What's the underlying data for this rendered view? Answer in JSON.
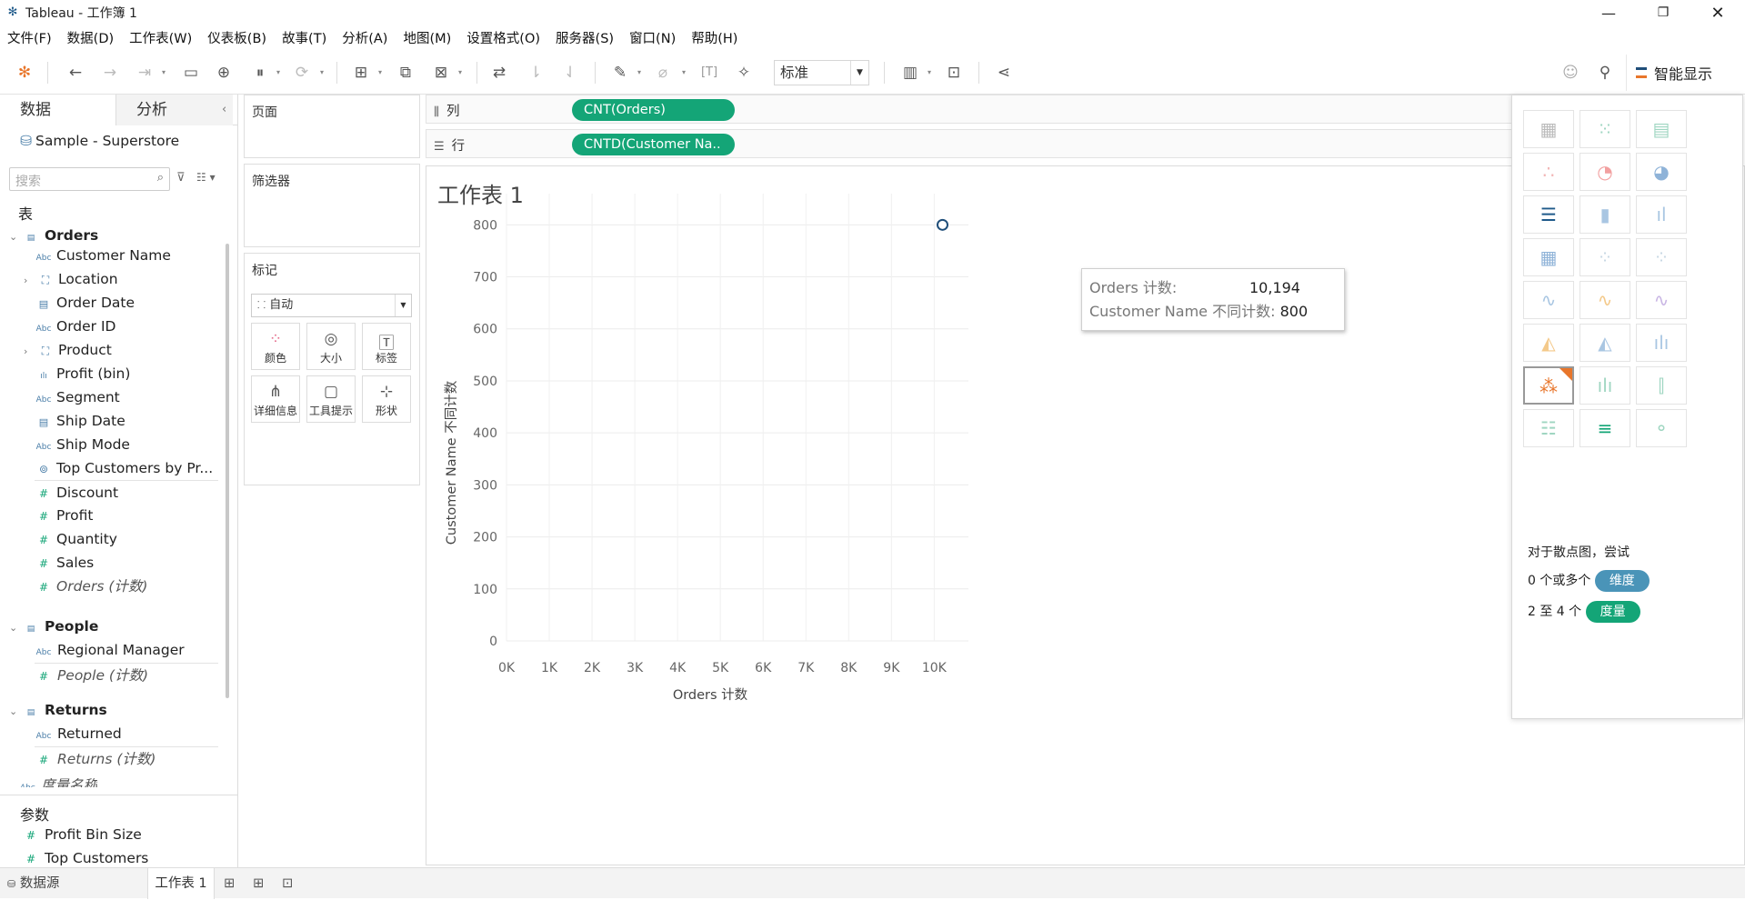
{
  "window": {
    "title": "Tableau - 工作簿 1"
  },
  "menu": [
    "文件(F)",
    "数据(D)",
    "工作表(W)",
    "仪表板(B)",
    "故事(T)",
    "分析(A)",
    "地图(M)",
    "设置格式(O)",
    "服务器(S)",
    "窗口(N)",
    "帮助(H)"
  ],
  "toolbar": {
    "view_mode": "标准",
    "smart_display": "智能显示"
  },
  "left_pane": {
    "tabs": [
      "数据",
      "分析"
    ],
    "datasource": "Sample - Superstore",
    "search_placeholder": "搜索",
    "tables_header": "表",
    "orders_table": "Orders",
    "orders_fields": [
      {
        "type": "Abc",
        "name": "Customer Name"
      },
      {
        "type": "geo",
        "name": "Location"
      },
      {
        "type": "date",
        "name": "Order Date"
      },
      {
        "type": "Abc",
        "name": "Order ID"
      },
      {
        "type": "geo",
        "name": "Product"
      },
      {
        "type": "bin",
        "name": "Profit (bin)"
      },
      {
        "type": "Abc",
        "name": "Segment"
      },
      {
        "type": "date",
        "name": "Ship Date"
      },
      {
        "type": "Abc",
        "name": "Ship Mode"
      },
      {
        "type": "set",
        "name": "Top Customers by Pr..."
      },
      {
        "type": "#",
        "name": "Discount"
      },
      {
        "type": "#",
        "name": "Profit"
      },
      {
        "type": "#",
        "name": "Quantity"
      },
      {
        "type": "#",
        "name": "Sales"
      },
      {
        "type": "#",
        "name": "Orders (计数)"
      }
    ],
    "people_table": "People",
    "people_fields": [
      {
        "type": "Abc",
        "name": "Regional Manager"
      },
      {
        "type": "#",
        "name": "People (计数)"
      }
    ],
    "returns_table": "Returns",
    "returns_fields": [
      {
        "type": "Abc",
        "name": "Returned"
      },
      {
        "type": "#",
        "name": "Returns (计数)"
      }
    ],
    "measure_names": "度量名称",
    "params_header": "参数",
    "params": [
      "Profit Bin Size",
      "Top Customers"
    ]
  },
  "shelves": {
    "pages": "页面",
    "filters": "筛选器",
    "marks": "标记",
    "mark_type": "自动",
    "mark_buttons": [
      "颜色",
      "大小",
      "标签",
      "详细信息",
      "工具提示",
      "形状"
    ],
    "columns_label": "列",
    "rows_label": "行",
    "columns_pill": "CNT(Orders)",
    "rows_pill": "CNTD(Customer Na.."
  },
  "sheet": {
    "title": "工作表 1"
  },
  "chart_data": {
    "type": "scatter",
    "x": [
      10194
    ],
    "y": [
      800
    ],
    "xlabel": "Orders 计数",
    "ylabel": "Customer Name 不同计数",
    "xlim": [
      0,
      10800
    ],
    "ylim": [
      0,
      860
    ],
    "xticks": [
      "0K",
      "1K",
      "2K",
      "3K",
      "4K",
      "5K",
      "6K",
      "7K",
      "8K",
      "9K",
      "10K"
    ],
    "yticks": [
      "0",
      "100",
      "200",
      "300",
      "400",
      "500",
      "600",
      "700",
      "800"
    ],
    "grid": true,
    "marker_color": "#1f4e79"
  },
  "tooltip": {
    "row1_label": "Orders 计数:",
    "row1_value": "10,194",
    "row2_label": "Customer Name 不同计数:",
    "row2_value": "800"
  },
  "showme": {
    "hint": "对于散点图，尝试",
    "req1_text": "0 个或多个",
    "req1_pill": "维度",
    "req2_text": "2 至 4 个",
    "req2_pill": "度量",
    "colors": {
      "dimension": "#4a94b8",
      "measure": "#14a577"
    }
  },
  "bottom": {
    "datasource_tab": "数据源",
    "sheet_tab": "工作表 1"
  }
}
